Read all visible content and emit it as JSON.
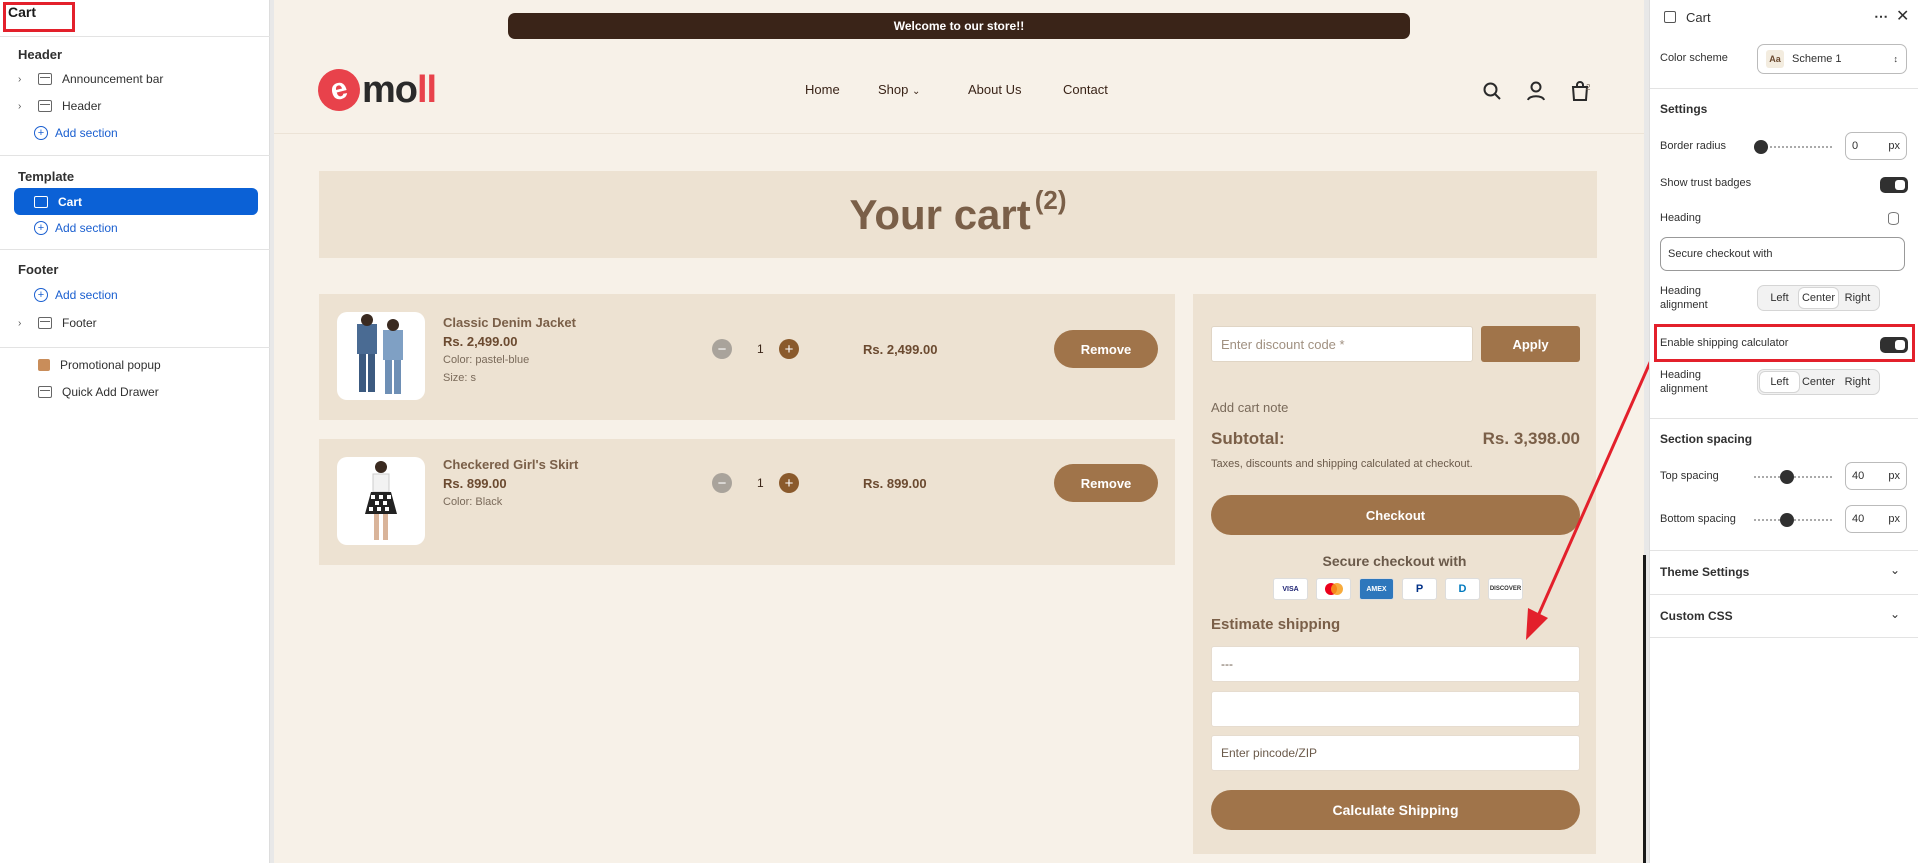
{
  "left_panel": {
    "title": "Cart",
    "header_group": "Header",
    "header_items": [
      "Announcement bar",
      "Header"
    ],
    "add_section": "Add section",
    "template_group": "Template",
    "template_selected": "Cart",
    "footer_group": "Footer",
    "footer_items": [
      "Footer"
    ],
    "overlay_items": [
      "Promotional popup",
      "Quick Add Drawer"
    ]
  },
  "store": {
    "announcement": "Welcome to our store!!",
    "logo_letter": "e",
    "logo_text": "mo",
    "logo_accent": "ll",
    "nav": [
      "Home",
      "Shop",
      "About Us",
      "Contact"
    ],
    "cart_count": "2",
    "cart_heading": "Your cart",
    "cart_heading_count": "(2)",
    "items": [
      {
        "name": "Classic Denim Jacket",
        "price": "Rs. 2,499.00",
        "variants": [
          "Color: pastel-blue",
          "Size: s"
        ],
        "qty": "1",
        "line_price": "Rs. 2,499.00",
        "remove": "Remove"
      },
      {
        "name": "Checkered Girl's Skirt",
        "price": "Rs. 899.00",
        "variants": [
          "Color: Black"
        ],
        "qty": "1",
        "line_price": "Rs. 899.00",
        "remove": "Remove"
      }
    ],
    "summary": {
      "discount_placeholder": "Enter discount code *",
      "apply": "Apply",
      "cart_note": "Add cart note",
      "subtotal_label": "Subtotal:",
      "subtotal_value": "Rs. 3,398.00",
      "tax_note": "Taxes, discounts and shipping calculated at checkout.",
      "checkout": "Checkout",
      "secure_heading": "Secure checkout with",
      "cards": [
        "VISA",
        "MC",
        "AMEX",
        "P",
        "D",
        "DISCOVER"
      ],
      "estimate_heading": "Estimate shipping",
      "country_value": "---",
      "province_value": "",
      "zip_placeholder": "Enter pincode/ZIP",
      "calculate": "Calculate Shipping"
    }
  },
  "right_panel": {
    "title": "Cart",
    "color_scheme_label": "Color scheme",
    "color_scheme_value": "Scheme 1",
    "color_scheme_icon": "Aa",
    "settings_heading": "Settings",
    "border_radius_label": "Border radius",
    "border_radius_value": "0",
    "unit": "px",
    "show_trust_badges": "Show trust badges",
    "heading_label": "Heading",
    "heading_value": "Secure checkout with",
    "heading_alignment": "Heading alignment",
    "align_options": [
      "Left",
      "Center",
      "Right"
    ],
    "enable_shipping": "Enable shipping calculator",
    "heading_alignment_2": "Heading alignment",
    "section_spacing": "Section spacing",
    "top_spacing": "Top spacing",
    "top_value": "40",
    "bottom_spacing": "Bottom spacing",
    "bottom_value": "40",
    "theme_settings": "Theme Settings",
    "custom_css": "Custom CSS"
  },
  "colors": {
    "accent": "#a0744a",
    "selected": "#0b61d6",
    "annotation": "#e3202b"
  }
}
